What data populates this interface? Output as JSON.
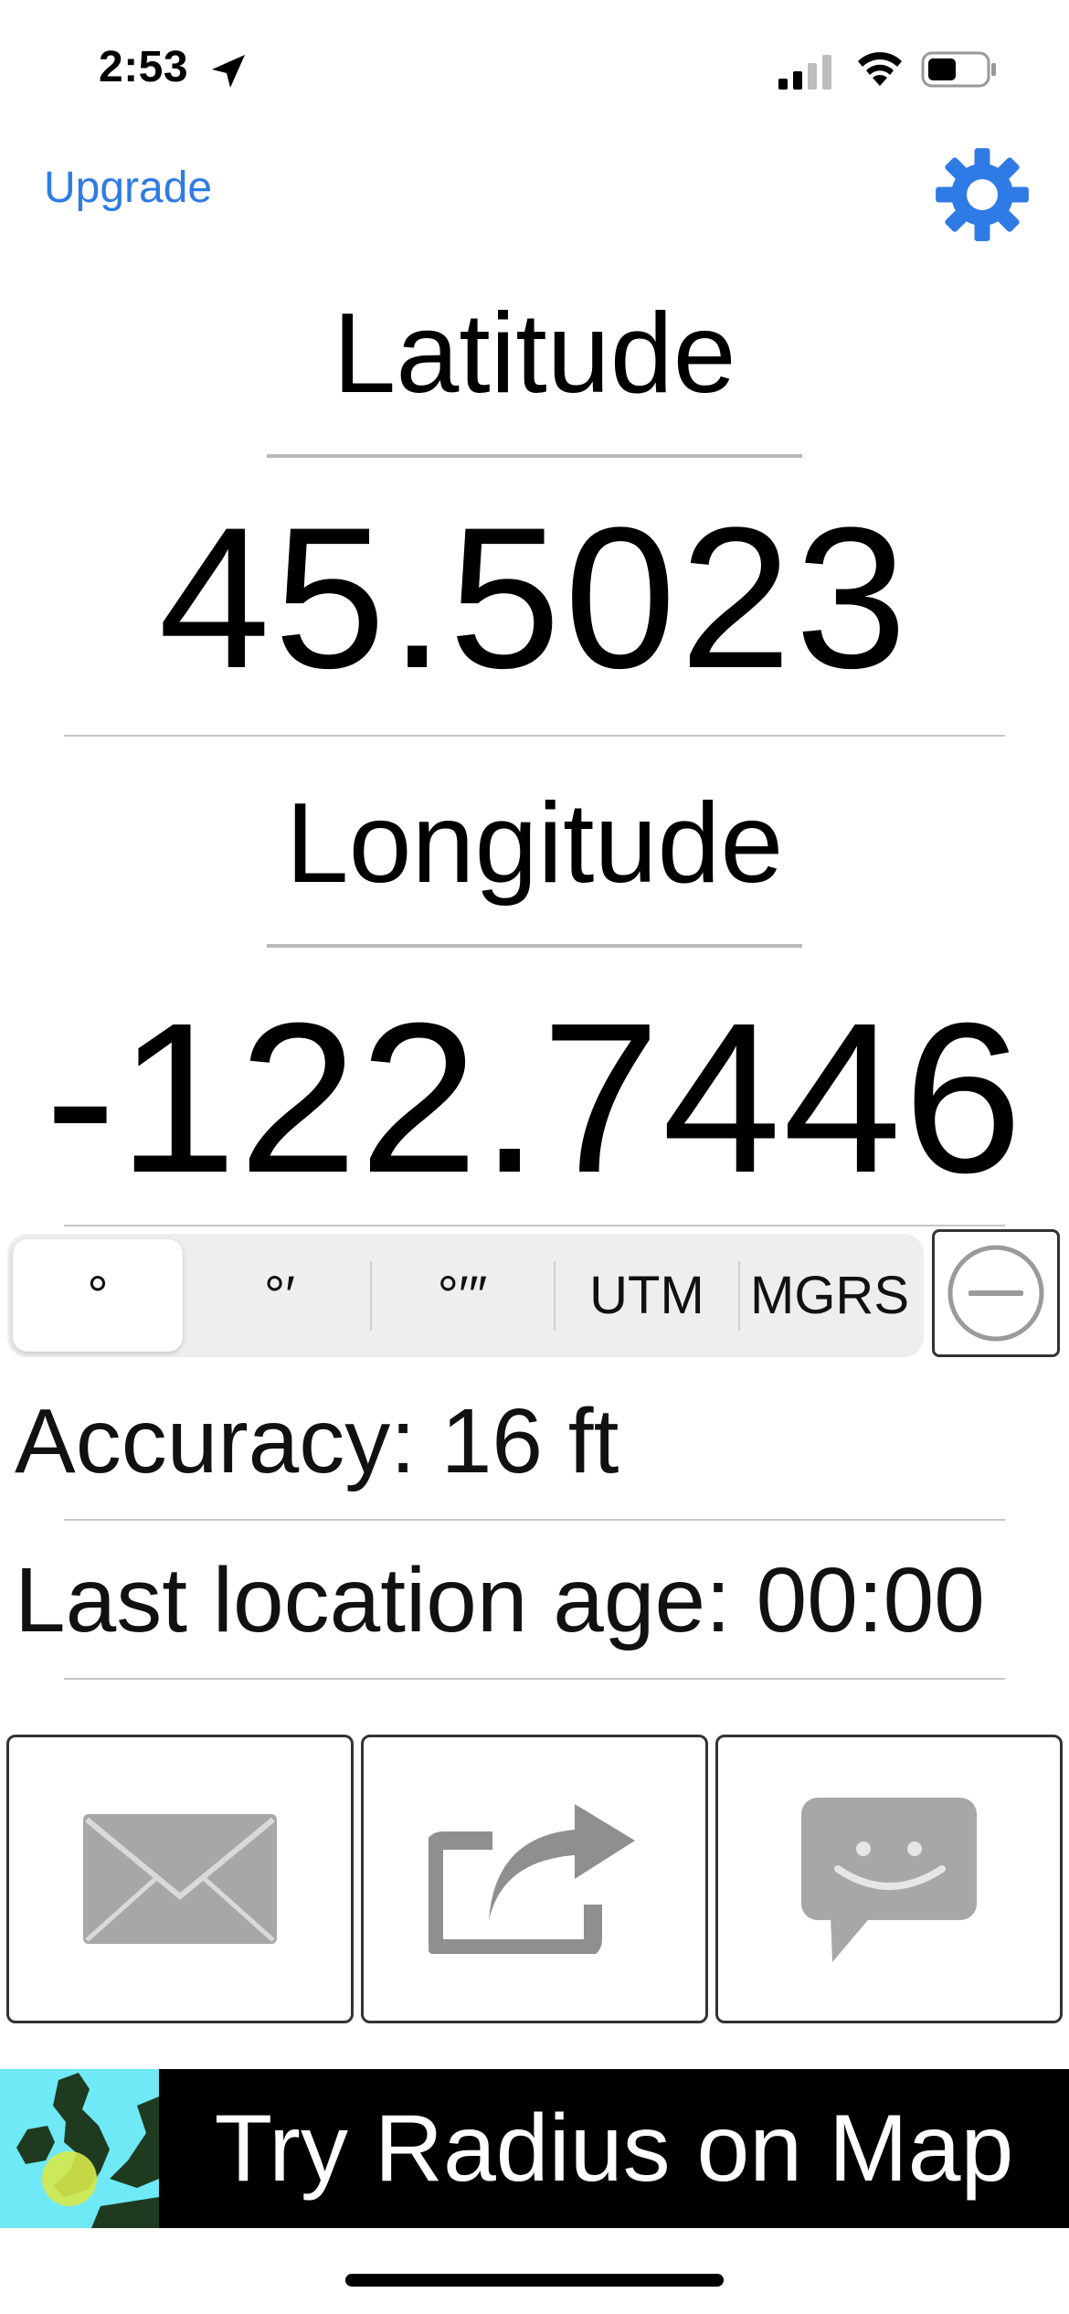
{
  "status_bar": {
    "time": "2:53",
    "icons": [
      "location-arrow-icon",
      "cellular-signal-icon",
      "wifi-icon",
      "battery-icon"
    ]
  },
  "header": {
    "upgrade_label": "Upgrade",
    "settings_icon": "gear-icon",
    "accent_color": "#2f7be5"
  },
  "latitude": {
    "label": "Latitude",
    "value": "45.5023"
  },
  "longitude": {
    "label": "Longitude",
    "value": "-122.7446"
  },
  "format_selector": {
    "options": [
      "°",
      "°′",
      "°′″",
      "UTM",
      "MGRS"
    ],
    "selected": "°"
  },
  "remove_icon": "minus-circle-icon",
  "accuracy": {
    "text": "Accuracy: 16 ft"
  },
  "location_age": {
    "text": "Last location age: 00:00"
  },
  "actions": [
    {
      "icon": "mail-icon"
    },
    {
      "icon": "share-icon"
    },
    {
      "icon": "message-icon"
    }
  ],
  "banner": {
    "text": "Try Radius on Map",
    "icon": "map-radius-icon"
  }
}
